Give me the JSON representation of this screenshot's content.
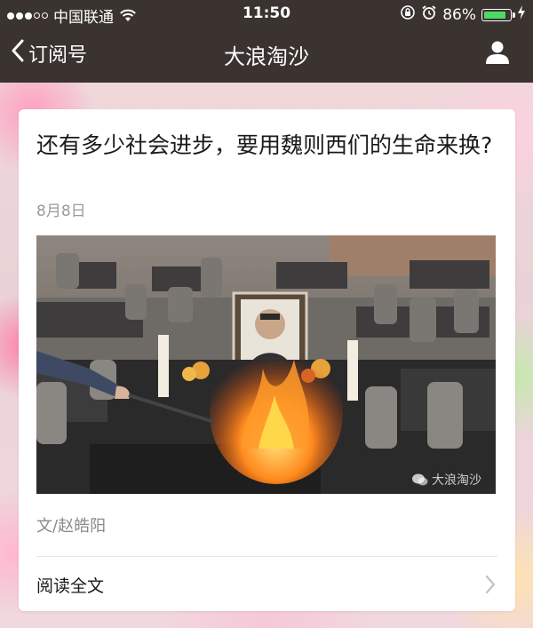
{
  "status_bar": {
    "carrier": "中国联通",
    "time": "11:50",
    "battery_percent": "86%",
    "battery_level": 0.86,
    "signal_strength": 3,
    "icons": [
      "signal-icon",
      "wifi-icon",
      "rotation-lock-icon",
      "alarm-icon",
      "battery-icon",
      "charging-icon"
    ]
  },
  "nav": {
    "back_label": "订阅号",
    "title": "大浪淘沙",
    "back_icon": "chevron-left-icon",
    "profile_icon": "person-icon"
  },
  "article": {
    "title": "还有多少社会进步，要用魏则西们的生命来换?",
    "date": "8月8日",
    "cover_watermark": "大浪淘沙",
    "author": "文/赵皓阳",
    "read_more": "阅读全文"
  },
  "colors": {
    "topbar": "#3a3330",
    "battery_fill": "#4cd964",
    "card_bg": "#ffffff"
  }
}
